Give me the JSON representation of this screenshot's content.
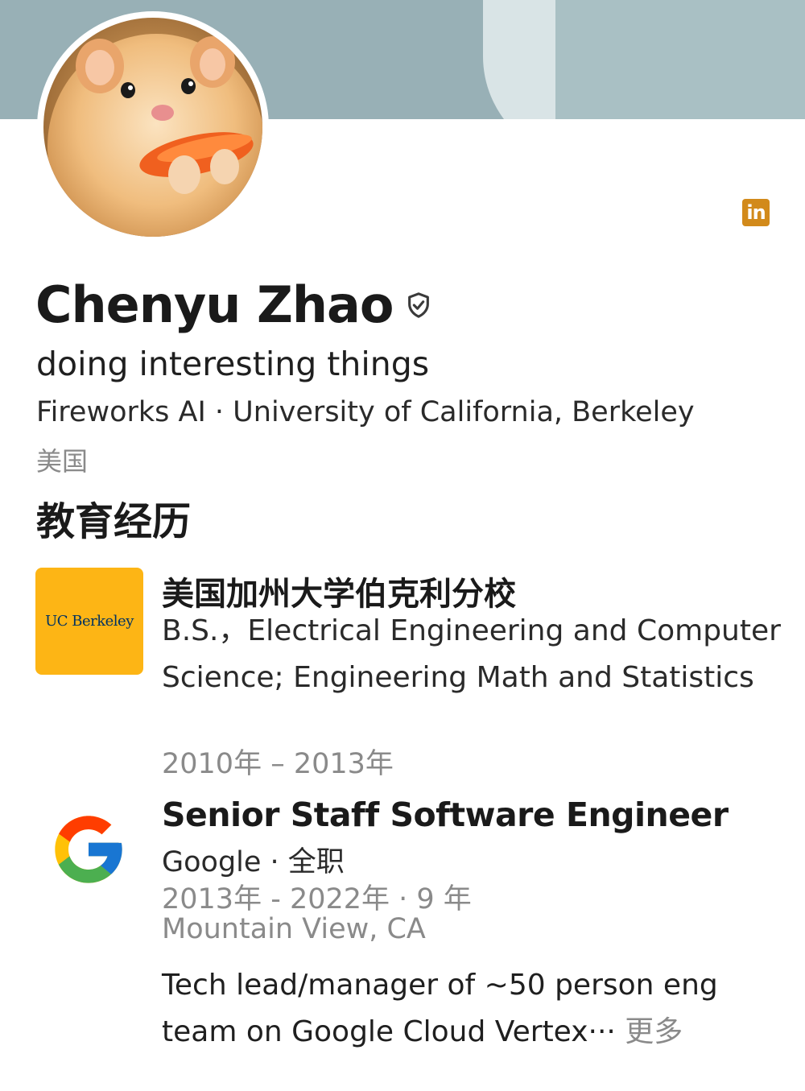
{
  "profile": {
    "name": "Chenyu Zhao",
    "headline": "doing interesting things",
    "organizations": "Fireworks AI · University of California, Berkeley",
    "location": "美国",
    "verified_icon": "shield-check-icon",
    "source_icon": "linkedin-icon",
    "source_icon_text": "in",
    "avatar": "hamster-eating-carrot-photo"
  },
  "education": {
    "section_title": "教育经历",
    "items": [
      {
        "logo_text": "UC Berkeley",
        "school": "美国加州大学伯克利分校",
        "degree": "B.S.，Electrical Engineering and Computer Science; Engineering Math and Statistics",
        "dates": "2010年 – 2013年"
      }
    ]
  },
  "experience": {
    "items": [
      {
        "logo": "google-g-logo",
        "title": "Senior Staff Software Engineer",
        "company": "Google · 全职",
        "dates": "2013年 - 2022年 · 9 年",
        "location": "Mountain View, CA",
        "description": "Tech lead/manager of ~50 person eng team on Google Cloud Vertex··· ",
        "more_label": "更多"
      }
    ]
  },
  "colors": {
    "banner": "#98b0b6",
    "linkedin": "#d28a1b",
    "berkeley_gold": "#fdb515",
    "berkeley_blue": "#003262",
    "muted_text": "#8a8a8a"
  }
}
